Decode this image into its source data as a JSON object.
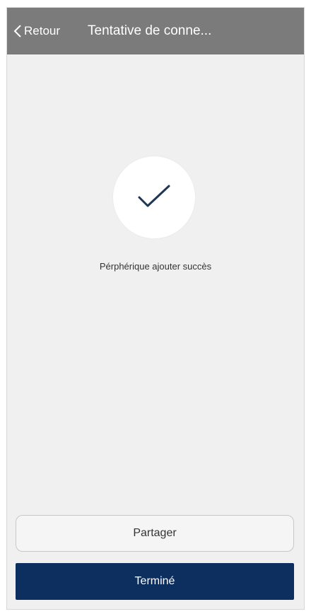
{
  "header": {
    "back_label": "Retour",
    "back_icon": "chevron-left-icon",
    "title": "Tentative de conne..."
  },
  "status": {
    "icon": "checkmark-icon",
    "message": "Pérphérique ajouter succès"
  },
  "actions": {
    "share_label": "Partager",
    "done_label": "Terminé"
  },
  "colors": {
    "header_bg": "#7b7b7b",
    "page_bg": "#f0f0f0",
    "primary": "#0d2f5f",
    "check": "#1f3654"
  }
}
